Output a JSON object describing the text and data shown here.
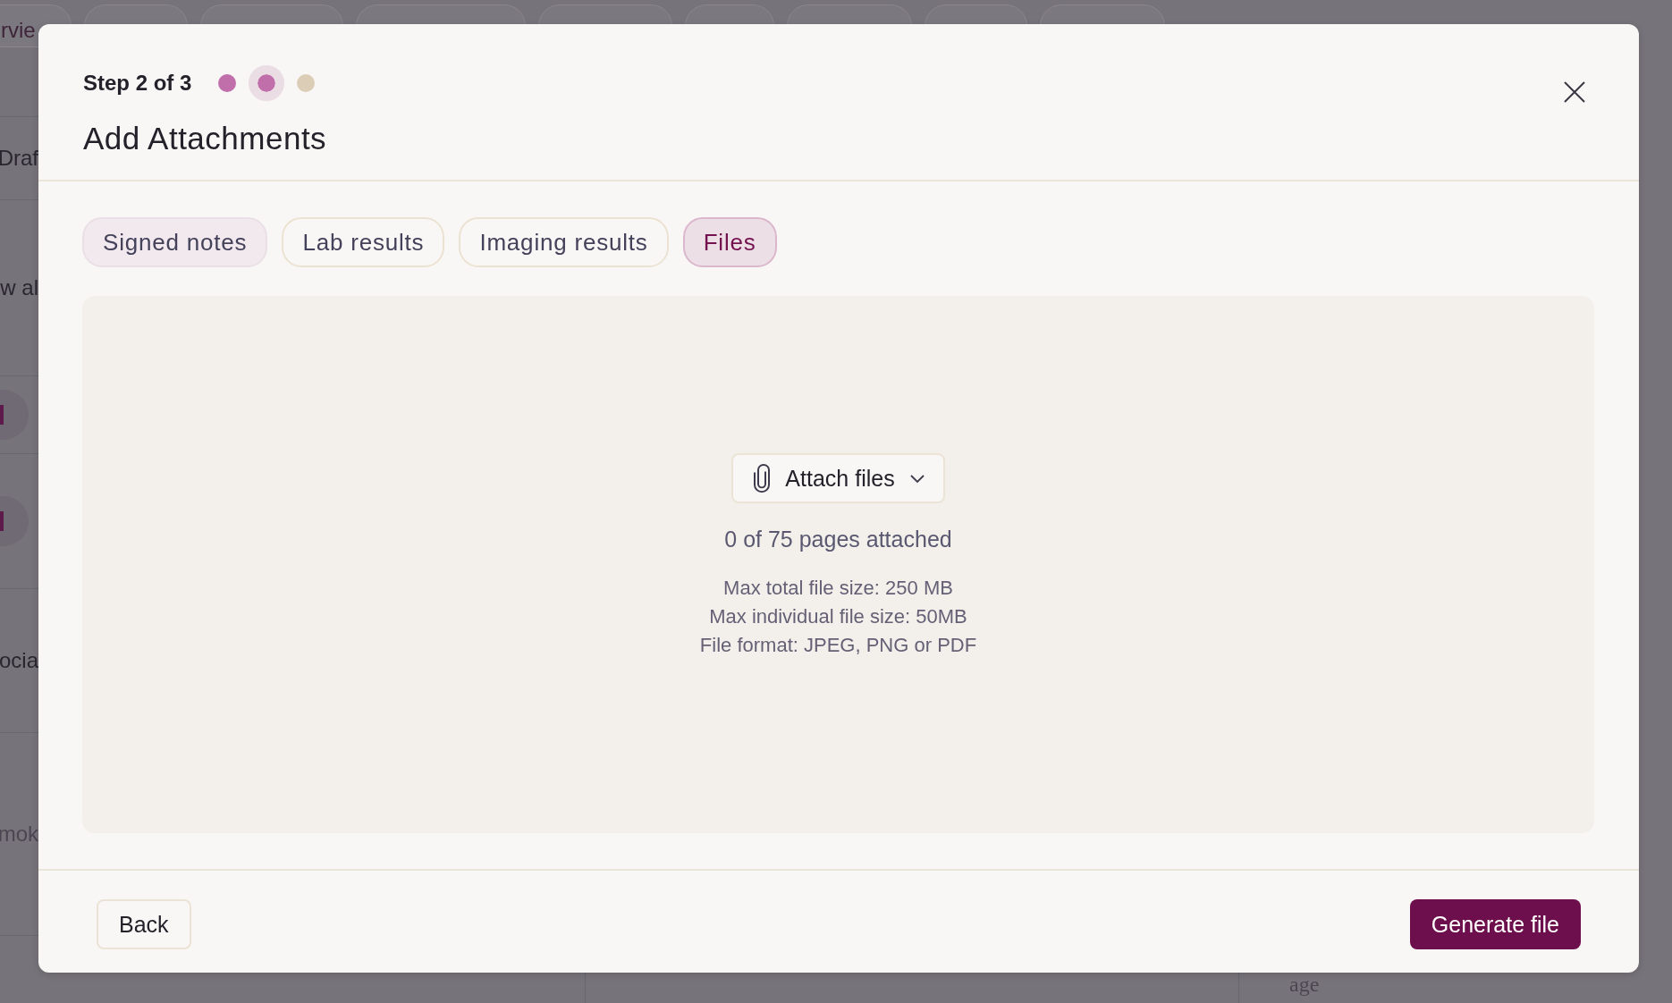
{
  "background": {
    "top_tab": "rvie",
    "left_fragments": [
      {
        "kind": "text",
        "text": "Draf"
      },
      {
        "kind": "text",
        "text": "w al"
      },
      {
        "kind": "badge"
      },
      {
        "kind": "badge"
      },
      {
        "kind": "text",
        "text": "ocia"
      },
      {
        "kind": "muted",
        "text": "mok"
      }
    ],
    "bottom_text": "age"
  },
  "dialog": {
    "step_label": "Step 2 of 3",
    "steps": [
      {
        "completed": true,
        "selected": false
      },
      {
        "completed": true,
        "selected": true
      },
      {
        "completed": false,
        "selected": false
      }
    ],
    "title": "Add Attachments",
    "tabs": [
      {
        "label": "Signed notes",
        "selected": false,
        "visited": true
      },
      {
        "label": "Lab results",
        "selected": false,
        "visited": false
      },
      {
        "label": "Imaging results",
        "selected": false,
        "visited": false
      },
      {
        "label": "Files",
        "selected": true,
        "visited": false
      }
    ],
    "attach_button": "Attach files",
    "pages_status": "0 of 75 pages attached",
    "limits": [
      "Max total file size: 250 MB",
      "Max individual file size: 50MB",
      "File format: JPEG, PNG or PDF"
    ],
    "back_button": "Back",
    "primary_button": "Generate file"
  }
}
